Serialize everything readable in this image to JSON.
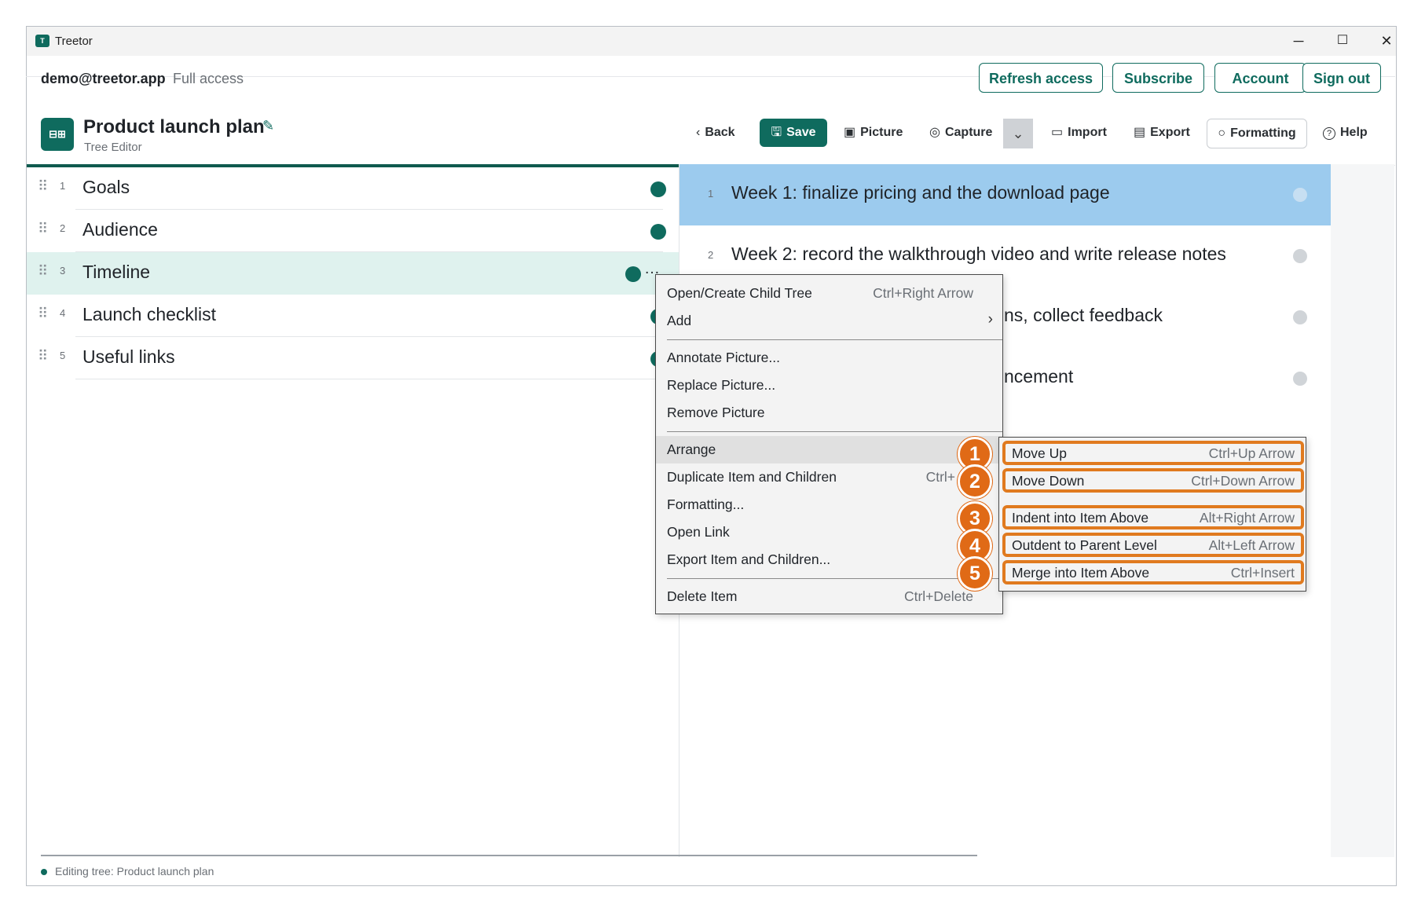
{
  "window": {
    "title": "Treetor",
    "minimize": "─",
    "maximize": "☐",
    "close": "✕",
    "logo_glyph": "T"
  },
  "account": {
    "email": "demo@treetor.app",
    "access": "Full access",
    "buttons": [
      "Refresh access",
      "Subscribe",
      "Account",
      "Sign out"
    ]
  },
  "document": {
    "title": "Product launch plan",
    "subtitle": "Tree Editor",
    "app_icon_glyph": "⊟⊞",
    "edit_icon": "✎"
  },
  "toolbar": {
    "back": "Back",
    "back_icon": "‹",
    "save": "Save",
    "save_icon": "🖫",
    "picture": "Picture",
    "picture_icon": "▣",
    "capture": "Capture",
    "capture_icon": "◎",
    "dropdown_icon": "⌄",
    "import": "Import",
    "import_icon": "▭",
    "export": "Export",
    "export_icon": "▤",
    "formatting": "Formatting",
    "formatting_icon": "○",
    "help": "Help",
    "help_icon": "?"
  },
  "left_items": [
    {
      "num": "1",
      "label": "Goals"
    },
    {
      "num": "2",
      "label": "Audience"
    },
    {
      "num": "3",
      "label": "Timeline",
      "selected": true
    },
    {
      "num": "4",
      "label": "Launch checklist"
    },
    {
      "num": "5",
      "label": "Useful links"
    }
  ],
  "grip_icon": "⠿",
  "more_icon": "…",
  "right_items": [
    {
      "num": "1",
      "label": "Week 1: finalize pricing and the download page",
      "highlighted": true
    },
    {
      "num": "2",
      "label": "Week 2: record the walkthrough video and write release notes"
    },
    {
      "num": "",
      "label": "ns, collect feedback"
    },
    {
      "num": "",
      "label": "ncement"
    }
  ],
  "context_menu": {
    "items": [
      {
        "label": "Open/Create Child Tree",
        "shortcut": "Ctrl+Right Arrow"
      },
      {
        "label": "Add",
        "shortcut": "",
        "submenu_icon": "›"
      },
      {
        "label": "Annotate Picture...",
        "shortcut": ""
      },
      {
        "label": "Replace Picture...",
        "shortcut": ""
      },
      {
        "label": "Remove Picture",
        "shortcut": ""
      },
      {
        "label": "Arrange",
        "shortcut": "",
        "active": true
      },
      {
        "label": "Duplicate Item and Children",
        "shortcut": "Ctrl+"
      },
      {
        "label": "Formatting...",
        "shortcut": ""
      },
      {
        "label": "Open Link",
        "shortcut": ""
      },
      {
        "label": "Export Item and Children...",
        "shortcut": ""
      },
      {
        "label": "Delete Item",
        "shortcut": "Ctrl+Delete"
      }
    ]
  },
  "arrange_submenu": {
    "items": [
      {
        "badge": "1",
        "label": "Move Up",
        "shortcut": "Ctrl+Up Arrow"
      },
      {
        "badge": "2",
        "label": "Move Down",
        "shortcut": "Ctrl+Down Arrow"
      },
      {
        "badge": "3",
        "label": "Indent into Item Above",
        "shortcut": "Alt+Right Arrow"
      },
      {
        "badge": "4",
        "label": "Outdent to Parent Level",
        "shortcut": "Alt+Left Arrow"
      },
      {
        "badge": "5",
        "label": "Merge into Item Above",
        "shortcut": "Ctrl+Insert"
      }
    ]
  },
  "status": {
    "text": "Editing tree: Product launch plan"
  },
  "colors": {
    "brand": "#0f6b5e",
    "highlight_row": "#9ccbee",
    "selected_row": "#dff2ee",
    "callout": "#e06a16"
  }
}
